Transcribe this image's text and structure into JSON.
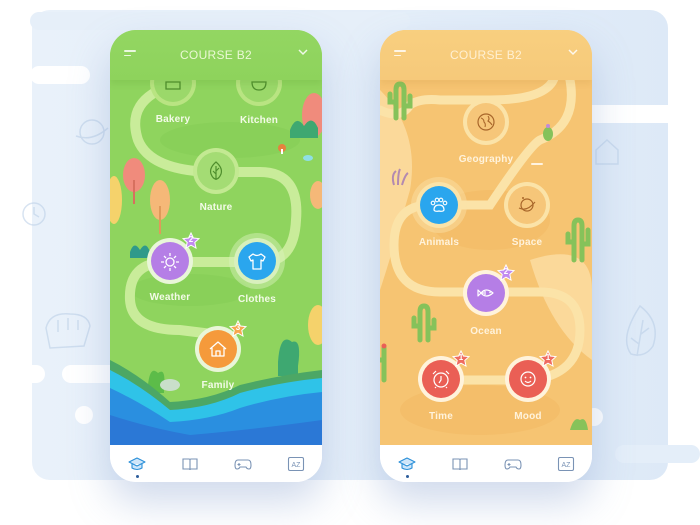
{
  "colors": {
    "green_bg": "#8fd45e",
    "sand_bg": "#f6c472",
    "path_green": "#c9ec9a",
    "path_sand": "#fbe3a8",
    "blue": "#2aa6ee",
    "purple": "#b57ee6",
    "orange": "#f59a3b",
    "red": "#ea5f55",
    "tab_icon": "#7a93b5",
    "tab_active": "#2a8fd8"
  },
  "screens": [
    {
      "id": "forest",
      "header": {
        "title": "COURSE B2",
        "menu_icon": "menu-icon",
        "chevron_icon": "chevron-down-icon"
      },
      "lessons": [
        {
          "label": "Bakery",
          "icon": "bread-icon",
          "state": "locked"
        },
        {
          "label": "Kitchen",
          "icon": "pot-icon",
          "state": "locked"
        },
        {
          "label": "Nature",
          "icon": "leaf-icon",
          "state": "locked"
        },
        {
          "label": "Weather",
          "icon": "sun-icon",
          "state": "completed",
          "stars": "2"
        },
        {
          "label": "Clothes",
          "icon": "shirt-icon",
          "state": "current"
        },
        {
          "label": "Family",
          "icon": "house-icon",
          "state": "completed",
          "stars": "3"
        }
      ],
      "tabs": [
        {
          "label": "Courses",
          "icon": "graduation-cap-icon",
          "active": true
        },
        {
          "label": "Reading",
          "icon": "book-icon",
          "active": false
        },
        {
          "label": "Games",
          "icon": "gamepad-icon",
          "active": false
        },
        {
          "label": "Dictionary",
          "icon": "az-dictionary-icon",
          "active": false
        }
      ]
    },
    {
      "id": "desert",
      "header": {
        "title": "COURSE B2",
        "menu_icon": "menu-icon",
        "chevron_icon": "chevron-down-icon"
      },
      "lessons": [
        {
          "label": "Geography",
          "icon": "globe-icon",
          "state": "locked"
        },
        {
          "label": "Animals",
          "icon": "paw-icon",
          "state": "current"
        },
        {
          "label": "Space",
          "icon": "planet-icon",
          "state": "locked"
        },
        {
          "label": "Ocean",
          "icon": "fish-icon",
          "state": "completed",
          "stars": "2"
        },
        {
          "label": "Time",
          "icon": "alarm-clock-icon",
          "state": "completed",
          "stars": "1"
        },
        {
          "label": "Mood",
          "icon": "smiley-icon",
          "state": "completed",
          "stars": "1"
        }
      ],
      "tabs": [
        {
          "label": "Courses",
          "icon": "graduation-cap-icon",
          "active": true
        },
        {
          "label": "Reading",
          "icon": "book-icon",
          "active": false
        },
        {
          "label": "Games",
          "icon": "gamepad-icon",
          "active": false
        },
        {
          "label": "Dictionary",
          "icon": "az-dictionary-icon",
          "active": false
        }
      ]
    }
  ]
}
